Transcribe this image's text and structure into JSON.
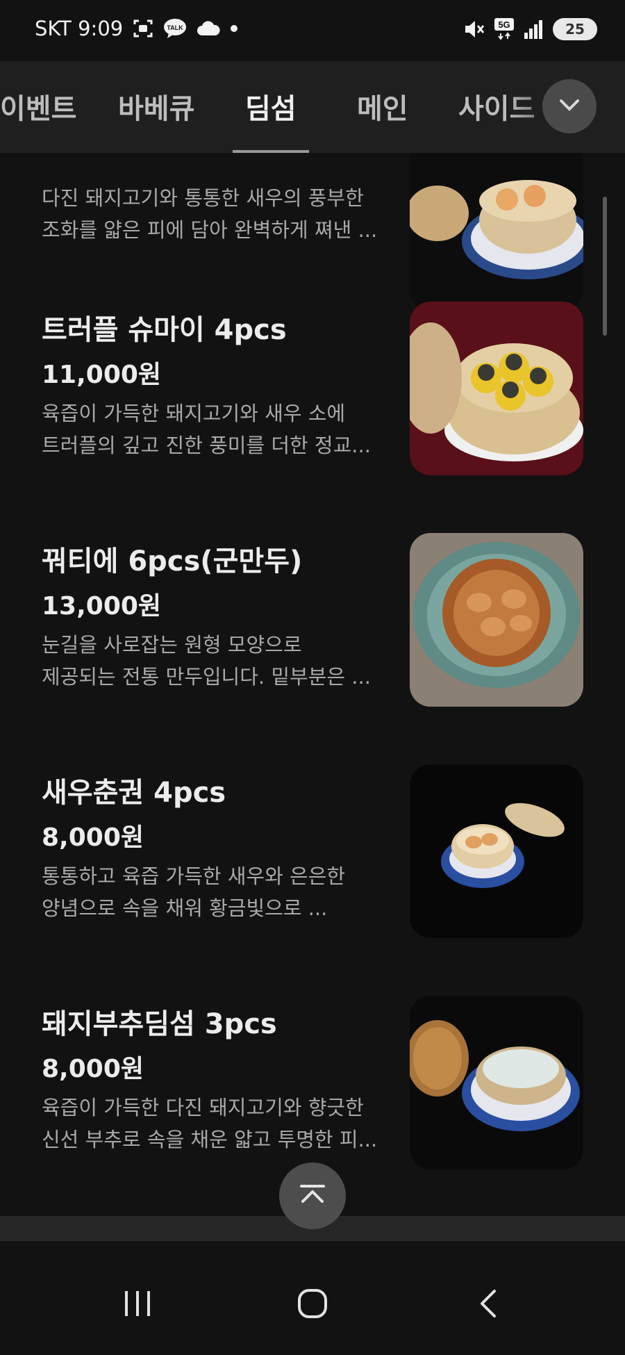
{
  "status_bar": {
    "carrier_time": "SKT 9:09",
    "talk_badge": "TALK",
    "network": "5G",
    "battery": "25",
    "icons": [
      "screenshot-icon",
      "talk-icon",
      "cloud-icon",
      "dot-icon",
      "mute-icon",
      "5g-icon",
      "signal-icon",
      "battery-icon"
    ]
  },
  "tabs": {
    "items": [
      {
        "label": "이벤트"
      },
      {
        "label": "바베큐"
      },
      {
        "label": "딤섬"
      },
      {
        "label": "메인"
      },
      {
        "label": "사이드"
      }
    ],
    "active": "딤섬"
  },
  "menu_items": [
    {
      "title": "",
      "price": "",
      "desc": [
        "다진 돼지고기와 통통한 새우의 풍부한",
        "조화를 얇은 피에 담아 완벽하게 쪄낸 ..."
      ],
      "image": "steamer-blue-plate"
    },
    {
      "title": "트러플 슈마이 4pcs",
      "price": "11,000원",
      "desc": [
        "육즙이 가득한 돼지고기와 새우 소에",
        "트러플의 깊고 진한 풍미를 더한 정교..."
      ],
      "image": "truffle-shumai"
    },
    {
      "title": "꿔티에 6pcs(군만두)",
      "price": "13,000원",
      "desc": [
        "눈길을 사로잡는 원형 모양으로",
        "제공되는 전통 만두입니다. 밑부분은 ..."
      ],
      "image": "potsticker-plate"
    },
    {
      "title": "새우춘권 4pcs",
      "price": "8,000원",
      "desc": [
        "통통하고 육즙 가득한 새우와 은은한",
        "양념으로 속을 채워 황금빛으로 ..."
      ],
      "image": "shrimp-spring-roll"
    },
    {
      "title": "돼지부추딤섬 3pcs",
      "price": "8,000원",
      "desc": [
        "육즙이 가득한 다진 돼지고기와 향긋한",
        "신선 부추로 속을 채운 얇고 투명한 피..."
      ],
      "image": "pork-chive-dimsum"
    }
  ],
  "colors": {
    "background": "#121212",
    "tab_bar": "#1f1f1f",
    "text_primary": "#ececec",
    "text_secondary": "#a9a9a9",
    "button": "#4a4a4a"
  },
  "nav": {
    "icons": [
      "recents-icon",
      "home-icon",
      "back-icon"
    ]
  }
}
